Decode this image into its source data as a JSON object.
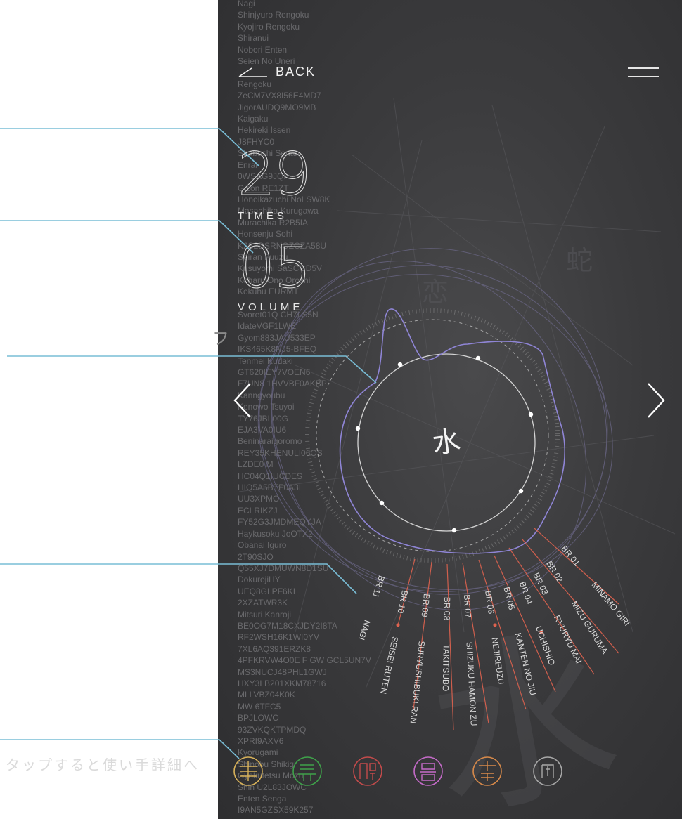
{
  "scroll_list": [
    "Nagi",
    "Shinjyuro Rengoku",
    "Kyojiro Rengoku",
    "Shiranui",
    "Nobori Enten",
    "Seien No Uneri",
    "",
    "Rengoku",
    "ZeCM7VX8I56E4MD7",
    "JigorAUDQ9MO9MB",
    "Kaigaku",
    "Hekireki Issen",
    "J8FHYC0",
    "Shabushi Senan",
    "Enrai",
    "0WSAG9JQI",
    "Gizon RE1ZT",
    "Honoikazuchi NoLSW8K",
    "Masachika Kurugawa",
    "Murachika R2B5IA",
    "Honsenju Sohi",
    "K2S2DSRNOZCZA58U",
    "Seiran Fuuzu",
    "Kusuyomi SaSCGD5V",
    "Koharu Ono Oroshi",
    "Kokuhu EURMT",
    "",
    "Svoret01Q CH7LS5N",
    "IdateVGF1LWE",
    "Gyom883JAU533EP",
    "IKS465K8NJ5-BFEQ",
    "Tenmei Kudaki",
    "GT620IEY7VOEN6",
    "F7UN8 1HVVBF0AKBP",
    "Kanngyoubu",
    "Kenowo Tsuyoi",
    "TY76JBL00G",
    "EJA3VA0IU6",
    "Beninaraigoromo",
    "REY35KHENULI06QS",
    "LZDE0 M",
    "HC04Q1IUCDES",
    "HIQ5A5BTF0A3I",
    "UU3XPMO",
    "ECLRIKZJ",
    "FY52G3JMDMEQYJA",
    "Haykusoku JoOTX2",
    "Obanai Iguro",
    "2T90SJO",
    "Q55XJ7DMUWN8D1SU",
    "DokurojiHY",
    "UEQ8GLPF6KI",
    "2XZATWR3K",
    "Mitsuri Kanroji",
    "BE0OG7M18CXJDY2I8TA",
    "RF2WSH16K1WI0YV",
    "7XL6AQ391ERZK8",
    "4PFKRVW4O0E F GW GCL5UN7V",
    "MS3NUCJ48PHL1GWJ",
    "HXY3LB201XKM78716",
    "MLLVBZ04K0K",
    "MW 6TFC5",
    "BPJLOWO",
    "93ZVKQKTPMDQ",
    "XPRI9AXV6",
    "Kyorugami",
    "Shinobu Shikigi",
    "Gyokutetsu Mozu",
    "Shin U2L83JOWC",
    "Enten Senga",
    "I9AN5GZSX59K257"
  ],
  "nav": {
    "back_label": "BACK"
  },
  "stats": {
    "times_value": "29",
    "times_label": "TIMES",
    "volume_value": "05",
    "volume_label": "VOLUME"
  },
  "center_kanji": "水",
  "hint_text": "タップすると使い手詳細へ",
  "hint_fragment": "フ",
  "colors": {
    "callout_line": "#79bdd6",
    "panel_bg": "#3b3b3d",
    "wave": "#8f85d6",
    "branch_line": "#e0634f"
  },
  "branches": [
    {
      "code": "BR 01",
      "name": "MINAMO GIRI"
    },
    {
      "code": "BR 02",
      "name": "MIZU GURUMA"
    },
    {
      "code": "BR 03",
      "name": "RYURYU MAI"
    },
    {
      "code": "BR 04",
      "name": "UCHISHIO"
    },
    {
      "code": "BR 05",
      "name": "KANTEN NO JIU"
    },
    {
      "code": "BR 06",
      "name": "NEJIREUZU"
    },
    {
      "code": "BR 07",
      "name": "SHIZUKU HAMON ZU"
    },
    {
      "code": "BR 08",
      "name": "TAKITSUBO"
    },
    {
      "code": "BR 09",
      "name": "SURYUSHIBUKI RAN"
    },
    {
      "code": "BR 10",
      "name": "SEISEI RUTEN"
    },
    {
      "code": "BR 11",
      "name": "NAGI"
    }
  ],
  "style_icons": [
    {
      "name": "style-icon-1",
      "color": "#d8b25a"
    },
    {
      "name": "style-icon-2",
      "color": "#3fa24a"
    },
    {
      "name": "style-icon-3",
      "color": "#c44b4b"
    },
    {
      "name": "style-icon-4",
      "color": "#c56bc9"
    },
    {
      "name": "style-icon-5",
      "color": "#d88a4a"
    },
    {
      "name": "style-icon-6",
      "color": "#a8a8a8"
    }
  ]
}
